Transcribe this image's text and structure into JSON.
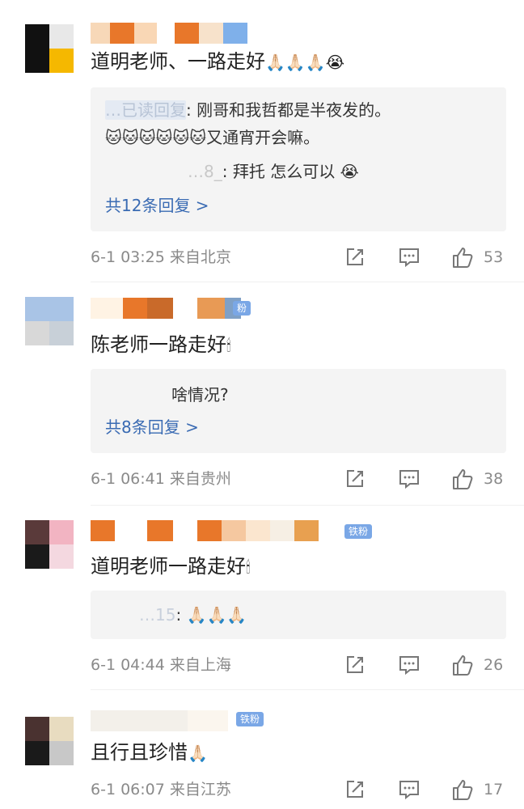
{
  "comments": [
    {
      "text": "道明老师、一路走好",
      "emoji": "🙏🏻🙏🏻🙏🏻😭",
      "replies": [
        {
          "author": "…已读回复",
          "text": "刚哥和我哲都是半夜发的。"
        },
        {
          "author": "",
          "text": "🐱🐱🐱🐱🐱🐱又通宵开会嘛。"
        },
        {
          "author": "…8_",
          "text": "拜托 怎么可以 😭"
        }
      ],
      "more": "共12条回复 >",
      "time": "6-1 03:25",
      "location": "来自北京",
      "likes": "53"
    },
    {
      "text": "陈老师一路走好",
      "emoji": "🕯",
      "fan_badge": "粉",
      "replies": [
        {
          "author": "",
          "text": "啥情况?"
        }
      ],
      "more": "共8条回复 >",
      "time": "6-1 06:41",
      "location": "来自贵州",
      "likes": "38"
    },
    {
      "text": "道明老师一路走好",
      "emoji": "🕯",
      "fan_badge": "铁粉",
      "replies": [
        {
          "author": "…15",
          "text": "🙏🏻🙏🏻🙏🏻"
        }
      ],
      "time": "6-1 04:44",
      "location": "来自上海",
      "likes": "26"
    },
    {
      "text": "且行且珍惜",
      "emoji": "🙏🏻",
      "fan_badge": "铁粉",
      "time": "6-1 06:07",
      "location": "来自江苏",
      "likes": "17"
    }
  ],
  "icons": {
    "share": "share-icon",
    "comment": "comment-icon",
    "like": "like-icon"
  },
  "colors": {
    "link": "#3a6bb3",
    "meta": "#8a8a8a",
    "reply_bg": "#f4f4f4",
    "fan_badge": "#7aa7e6"
  }
}
